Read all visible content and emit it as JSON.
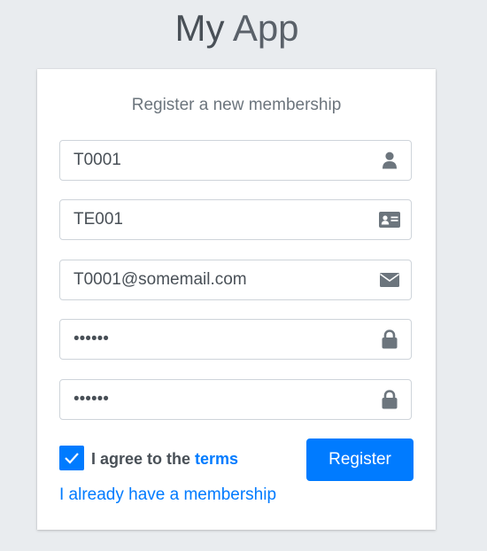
{
  "header": {
    "title_bold": "My",
    "title_light": "App"
  },
  "card": {
    "message": "Register a new membership",
    "fields": {
      "username": {
        "value": "T0001",
        "icon": "user-icon",
        "type": "text"
      },
      "code": {
        "value": "TE001",
        "icon": "id-card-icon",
        "type": "text"
      },
      "email": {
        "value": "T0001@somemail.com",
        "icon": "envelope-icon",
        "type": "text"
      },
      "password": {
        "value": "••••••",
        "icon": "lock-icon",
        "type": "password"
      },
      "password_confirm": {
        "value": "••••••",
        "icon": "lock-icon",
        "type": "password"
      }
    },
    "agree": {
      "checked": true,
      "label_prefix": "I agree to the",
      "terms_link": "terms"
    },
    "register_label": "Register",
    "membership_link": "I already have a membership"
  },
  "colors": {
    "accent": "#007bff",
    "background": "#e9ecef",
    "text": "#495057",
    "icon": "#6c757d"
  }
}
